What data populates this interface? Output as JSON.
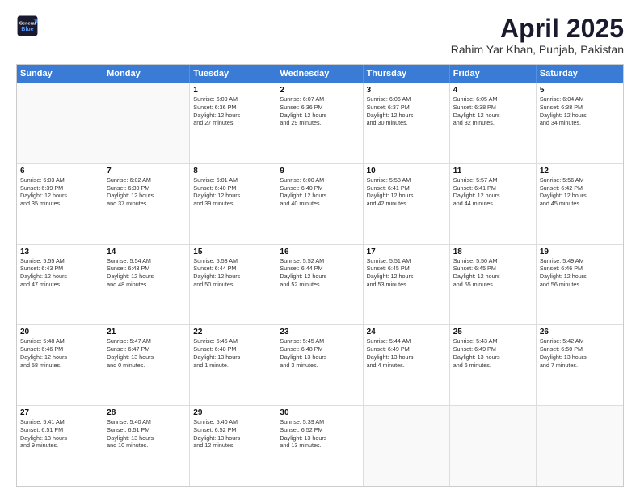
{
  "header": {
    "logo_line1": "General",
    "logo_line2": "Blue",
    "title": "April 2025",
    "subtitle": "Rahim Yar Khan, Punjab, Pakistan"
  },
  "days": [
    "Sunday",
    "Monday",
    "Tuesday",
    "Wednesday",
    "Thursday",
    "Friday",
    "Saturday"
  ],
  "rows": [
    [
      {
        "day": "",
        "empty": true
      },
      {
        "day": "",
        "empty": true
      },
      {
        "day": "1",
        "line1": "Sunrise: 6:09 AM",
        "line2": "Sunset: 6:36 PM",
        "line3": "Daylight: 12 hours",
        "line4": "and 27 minutes."
      },
      {
        "day": "2",
        "line1": "Sunrise: 6:07 AM",
        "line2": "Sunset: 6:36 PM",
        "line3": "Daylight: 12 hours",
        "line4": "and 29 minutes."
      },
      {
        "day": "3",
        "line1": "Sunrise: 6:06 AM",
        "line2": "Sunset: 6:37 PM",
        "line3": "Daylight: 12 hours",
        "line4": "and 30 minutes."
      },
      {
        "day": "4",
        "line1": "Sunrise: 6:05 AM",
        "line2": "Sunset: 6:38 PM",
        "line3": "Daylight: 12 hours",
        "line4": "and 32 minutes."
      },
      {
        "day": "5",
        "line1": "Sunrise: 6:04 AM",
        "line2": "Sunset: 6:38 PM",
        "line3": "Daylight: 12 hours",
        "line4": "and 34 minutes."
      }
    ],
    [
      {
        "day": "6",
        "line1": "Sunrise: 6:03 AM",
        "line2": "Sunset: 6:39 PM",
        "line3": "Daylight: 12 hours",
        "line4": "and 35 minutes."
      },
      {
        "day": "7",
        "line1": "Sunrise: 6:02 AM",
        "line2": "Sunset: 6:39 PM",
        "line3": "Daylight: 12 hours",
        "line4": "and 37 minutes."
      },
      {
        "day": "8",
        "line1": "Sunrise: 6:01 AM",
        "line2": "Sunset: 6:40 PM",
        "line3": "Daylight: 12 hours",
        "line4": "and 39 minutes."
      },
      {
        "day": "9",
        "line1": "Sunrise: 6:00 AM",
        "line2": "Sunset: 6:40 PM",
        "line3": "Daylight: 12 hours",
        "line4": "and 40 minutes."
      },
      {
        "day": "10",
        "line1": "Sunrise: 5:58 AM",
        "line2": "Sunset: 6:41 PM",
        "line3": "Daylight: 12 hours",
        "line4": "and 42 minutes."
      },
      {
        "day": "11",
        "line1": "Sunrise: 5:57 AM",
        "line2": "Sunset: 6:41 PM",
        "line3": "Daylight: 12 hours",
        "line4": "and 44 minutes."
      },
      {
        "day": "12",
        "line1": "Sunrise: 5:56 AM",
        "line2": "Sunset: 6:42 PM",
        "line3": "Daylight: 12 hours",
        "line4": "and 45 minutes."
      }
    ],
    [
      {
        "day": "13",
        "line1": "Sunrise: 5:55 AM",
        "line2": "Sunset: 6:43 PM",
        "line3": "Daylight: 12 hours",
        "line4": "and 47 minutes."
      },
      {
        "day": "14",
        "line1": "Sunrise: 5:54 AM",
        "line2": "Sunset: 6:43 PM",
        "line3": "Daylight: 12 hours",
        "line4": "and 48 minutes."
      },
      {
        "day": "15",
        "line1": "Sunrise: 5:53 AM",
        "line2": "Sunset: 6:44 PM",
        "line3": "Daylight: 12 hours",
        "line4": "and 50 minutes."
      },
      {
        "day": "16",
        "line1": "Sunrise: 5:52 AM",
        "line2": "Sunset: 6:44 PM",
        "line3": "Daylight: 12 hours",
        "line4": "and 52 minutes."
      },
      {
        "day": "17",
        "line1": "Sunrise: 5:51 AM",
        "line2": "Sunset: 6:45 PM",
        "line3": "Daylight: 12 hours",
        "line4": "and 53 minutes."
      },
      {
        "day": "18",
        "line1": "Sunrise: 5:50 AM",
        "line2": "Sunset: 6:45 PM",
        "line3": "Daylight: 12 hours",
        "line4": "and 55 minutes."
      },
      {
        "day": "19",
        "line1": "Sunrise: 5:49 AM",
        "line2": "Sunset: 6:46 PM",
        "line3": "Daylight: 12 hours",
        "line4": "and 56 minutes."
      }
    ],
    [
      {
        "day": "20",
        "line1": "Sunrise: 5:48 AM",
        "line2": "Sunset: 6:46 PM",
        "line3": "Daylight: 12 hours",
        "line4": "and 58 minutes."
      },
      {
        "day": "21",
        "line1": "Sunrise: 5:47 AM",
        "line2": "Sunset: 6:47 PM",
        "line3": "Daylight: 13 hours",
        "line4": "and 0 minutes."
      },
      {
        "day": "22",
        "line1": "Sunrise: 5:46 AM",
        "line2": "Sunset: 6:48 PM",
        "line3": "Daylight: 13 hours",
        "line4": "and 1 minute."
      },
      {
        "day": "23",
        "line1": "Sunrise: 5:45 AM",
        "line2": "Sunset: 6:48 PM",
        "line3": "Daylight: 13 hours",
        "line4": "and 3 minutes."
      },
      {
        "day": "24",
        "line1": "Sunrise: 5:44 AM",
        "line2": "Sunset: 6:49 PM",
        "line3": "Daylight: 13 hours",
        "line4": "and 4 minutes."
      },
      {
        "day": "25",
        "line1": "Sunrise: 5:43 AM",
        "line2": "Sunset: 6:49 PM",
        "line3": "Daylight: 13 hours",
        "line4": "and 6 minutes."
      },
      {
        "day": "26",
        "line1": "Sunrise: 5:42 AM",
        "line2": "Sunset: 6:50 PM",
        "line3": "Daylight: 13 hours",
        "line4": "and 7 minutes."
      }
    ],
    [
      {
        "day": "27",
        "line1": "Sunrise: 5:41 AM",
        "line2": "Sunset: 6:51 PM",
        "line3": "Daylight: 13 hours",
        "line4": "and 9 minutes."
      },
      {
        "day": "28",
        "line1": "Sunrise: 5:40 AM",
        "line2": "Sunset: 6:51 PM",
        "line3": "Daylight: 13 hours",
        "line4": "and 10 minutes."
      },
      {
        "day": "29",
        "line1": "Sunrise: 5:40 AM",
        "line2": "Sunset: 6:52 PM",
        "line3": "Daylight: 13 hours",
        "line4": "and 12 minutes."
      },
      {
        "day": "30",
        "line1": "Sunrise: 5:39 AM",
        "line2": "Sunset: 6:52 PM",
        "line3": "Daylight: 13 hours",
        "line4": "and 13 minutes."
      },
      {
        "day": "",
        "empty": true
      },
      {
        "day": "",
        "empty": true
      },
      {
        "day": "",
        "empty": true
      }
    ]
  ]
}
